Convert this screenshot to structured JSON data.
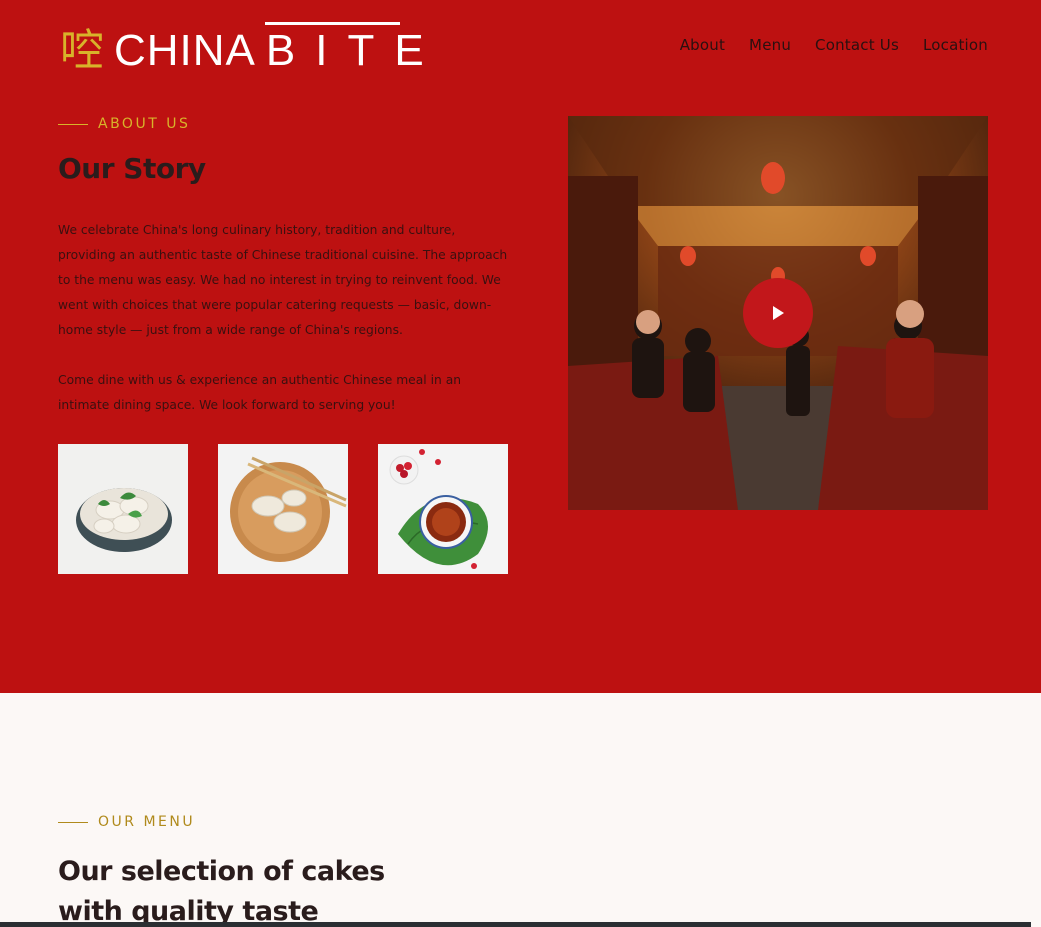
{
  "brand": {
    "glyph": "啌",
    "name_part1": "CHINA",
    "name_part2": "BITE"
  },
  "nav": {
    "items": [
      {
        "label": "About"
      },
      {
        "label": "Menu"
      },
      {
        "label": "Contact Us"
      },
      {
        "label": "Location"
      }
    ]
  },
  "about": {
    "eyebrow": "ABOUT US",
    "title": "Our Story",
    "paragraph1": "We celebrate China's long culinary history, tradition and culture, providing an authentic taste of Chinese traditional cuisine. The approach to the menu was easy. We had no interest in trying to reinvent food. We went with choices that were popular catering requests — basic, down-home style — just from a wide range of China's regions.",
    "paragraph2": "Come dine with us & experience an authentic Chinese meal in an intimate dining space. We look forward to serving you!"
  },
  "menu_section": {
    "eyebrow": "OUR MENU",
    "title_line1": "Our selection of cakes",
    "title_line2": "with quality taste"
  },
  "colors": {
    "hero_bg": "#bd1111",
    "accent_gold": "#d8b32a",
    "page_bg": "#fcf8f6"
  },
  "icons": {
    "play": "play-icon"
  }
}
